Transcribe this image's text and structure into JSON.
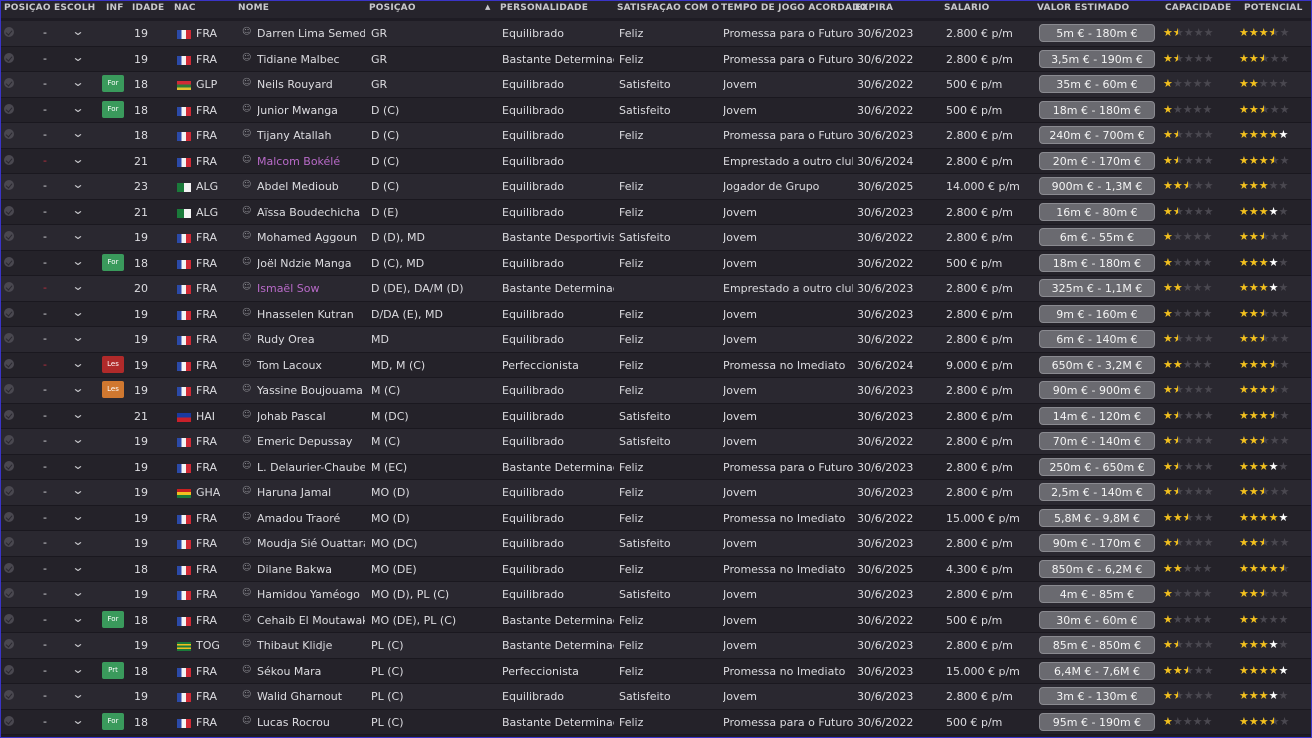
{
  "headers": {
    "posicao_escolhida": "POSIÇÃO ESCOLHIDA",
    "inf": "INF",
    "idade": "IDADE",
    "nac": "NAC",
    "nome": "NOME",
    "posicao": "POSIÇÃO",
    "personalidade": "PERSONALIDADE",
    "satisfacao": "SATISFAÇÃO COM O TE...",
    "tempo": "TEMPO DE JOGO ACORDADO",
    "expira": "EXPIRA",
    "salario": "SALÁRIO",
    "valor": "VALOR ESTIMADO",
    "capacidade": "CAPACIDADE",
    "potencial": "POTENCIAL"
  },
  "colors": {
    "star": "#f2c01e",
    "loan_name": "#b86ac8",
    "for_badge": "#3a9a5c",
    "les_badge_red": "#b02a2a",
    "les_badge_orange": "#d07830"
  },
  "players": [
    {
      "dash": "-",
      "inf": "",
      "age": "19",
      "flag": "fra",
      "nac": "FRA",
      "name": "Darren Lima Semedo",
      "pos": "GR",
      "pers": "Equilibrado",
      "sat": "Feliz",
      "tempo": "Promessa para o Futuro",
      "exp": "30/6/2023",
      "sal": "2.800 € p/m",
      "val": "5m € - 180m €",
      "cap": "1.5",
      "pot": "3.5"
    },
    {
      "dash": "-",
      "inf": "",
      "age": "19",
      "flag": "fra",
      "nac": "FRA",
      "name": "Tidiane Malbec",
      "pos": "GR",
      "pers": "Bastante Determinado",
      "sat": "Feliz",
      "tempo": "Promessa para o Futuro",
      "exp": "30/6/2022",
      "sal": "2.800 € p/m",
      "val": "3,5m € - 190m €",
      "cap": "1.5",
      "pot": "2.5"
    },
    {
      "dash": "-",
      "inf": "For",
      "age": "18",
      "flag": "glp",
      "nac": "GLP",
      "name": "Neils Rouyard",
      "pos": "GR",
      "pers": "Equilibrado",
      "sat": "Satisfeito",
      "tempo": "Jovem",
      "exp": "30/6/2022",
      "sal": "500 € p/m",
      "val": "35m € - 60m €",
      "cap": "1",
      "pot": "2"
    },
    {
      "dash": "-",
      "inf": "For",
      "age": "18",
      "flag": "fra",
      "nac": "FRA",
      "name": "Junior Mwanga",
      "pos": "D (C)",
      "pers": "Equilibrado",
      "sat": "Satisfeito",
      "tempo": "Jovem",
      "exp": "30/6/2022",
      "sal": "500 € p/m",
      "val": "18m € - 180m €",
      "cap": "1",
      "pot": "2.5"
    },
    {
      "dash": "-",
      "inf": "",
      "age": "18",
      "flag": "fra",
      "nac": "FRA",
      "name": "Tijany Atallah",
      "pos": "D (C)",
      "pers": "Equilibrado",
      "sat": "Feliz",
      "tempo": "Promessa para o Futuro",
      "exp": "30/6/2023",
      "sal": "2.800 € p/m",
      "val": "240m € - 700m €",
      "cap": "1.5",
      "pot": "4w"
    },
    {
      "dash": "-",
      "red": true,
      "inf": "",
      "age": "21",
      "flag": "fra",
      "nac": "FRA",
      "name": "Malcom Bokélé",
      "loan": true,
      "pos": "D (C)",
      "pers": "Equilibrado",
      "sat": "",
      "tempo": "Emprestado a outro clube",
      "exp": "30/6/2024",
      "sal": "2.800 € p/m",
      "val": "20m € - 170m €",
      "cap": "1.5",
      "pot": "3.5"
    },
    {
      "dash": "-",
      "inf": "",
      "age": "23",
      "flag": "alg",
      "nac": "ALG",
      "name": "Abdel Medioub",
      "pos": "D (C)",
      "pers": "Equilibrado",
      "sat": "Feliz",
      "tempo": "Jogador de Grupo",
      "exp": "30/6/2025",
      "sal": "14.000 € p/m",
      "val": "900m € - 1,3M €",
      "cap": "2.5",
      "pot": "3"
    },
    {
      "dash": "-",
      "inf": "",
      "age": "21",
      "flag": "alg",
      "nac": "ALG",
      "name": "Aïssa Boudechicha",
      "pos": "D (E)",
      "pers": "Equilibrado",
      "sat": "Feliz",
      "tempo": "Jovem",
      "exp": "30/6/2023",
      "sal": "2.800 € p/m",
      "val": "16m € - 80m €",
      "cap": "1.5",
      "pot": "3w"
    },
    {
      "dash": "-",
      "inf": "",
      "age": "19",
      "flag": "fra",
      "nac": "FRA",
      "name": "Mohamed Aggoun",
      "pos": "D (D), MD",
      "pers": "Bastante Desportivista",
      "sat": "Satisfeito",
      "tempo": "Jovem",
      "exp": "30/6/2022",
      "sal": "2.800 € p/m",
      "val": "6m € - 55m €",
      "cap": "1",
      "pot": "2.5"
    },
    {
      "dash": "-",
      "inf": "For",
      "age": "18",
      "flag": "fra",
      "nac": "FRA",
      "name": "Joël Ndzie Manga",
      "pos": "D (C), MD",
      "pers": "Equilibrado",
      "sat": "Feliz",
      "tempo": "Jovem",
      "exp": "30/6/2022",
      "sal": "500 € p/m",
      "val": "18m € - 180m €",
      "cap": "1",
      "pot": "3w"
    },
    {
      "dash": "-",
      "red": true,
      "inf": "",
      "age": "20",
      "flag": "fra",
      "nac": "FRA",
      "name": "Ismaël Sow",
      "loan": true,
      "pos": "D (DE), DA/M (D)",
      "pers": "Bastante Determinado",
      "sat": "",
      "tempo": "Emprestado a outro clube",
      "exp": "30/6/2023",
      "sal": "2.800 € p/m",
      "val": "325m € - 1,1M €",
      "cap": "2",
      "pot": "3w"
    },
    {
      "dash": "-",
      "inf": "",
      "age": "19",
      "flag": "fra",
      "nac": "FRA",
      "name": "Hnasselen Kutran",
      "pos": "D/DA (E), MD",
      "pers": "Equilibrado",
      "sat": "Feliz",
      "tempo": "Jovem",
      "exp": "30/6/2023",
      "sal": "2.800 € p/m",
      "val": "9m € - 160m €",
      "cap": "1",
      "pot": "2.5"
    },
    {
      "dash": "-",
      "inf": "",
      "age": "19",
      "flag": "fra",
      "nac": "FRA",
      "name": "Rudy Orea",
      "pos": "MD",
      "pers": "Equilibrado",
      "sat": "Feliz",
      "tempo": "Jovem",
      "exp": "30/6/2022",
      "sal": "2.800 € p/m",
      "val": "6m € - 140m €",
      "cap": "1.5",
      "pot": "2.5"
    },
    {
      "dash": "-",
      "red": true,
      "inf": "Les",
      "infType": "les-red",
      "age": "19",
      "flag": "fra",
      "nac": "FRA",
      "name": "Tom Lacoux",
      "pos": "MD, M (C)",
      "pers": "Perfeccionista",
      "sat": "Feliz",
      "tempo": "Promessa no Imediato",
      "exp": "30/6/2024",
      "sal": "9.000 € p/m",
      "val": "650m € - 3,2M €",
      "cap": "2",
      "pot": "3.5"
    },
    {
      "dash": "-",
      "inf": "Les",
      "infType": "les-orange",
      "age": "19",
      "flag": "fra",
      "nac": "FRA",
      "name": "Yassine Boujouama",
      "pos": "M (C)",
      "pers": "Equilibrado",
      "sat": "Feliz",
      "tempo": "Jovem",
      "exp": "30/6/2023",
      "sal": "2.800 € p/m",
      "val": "90m € - 900m €",
      "cap": "1.5",
      "pot": "3.5"
    },
    {
      "dash": "-",
      "inf": "",
      "age": "21",
      "flag": "hai",
      "nac": "HAI",
      "name": "Johab Pascal",
      "pos": "M (DC)",
      "pers": "Equilibrado",
      "sat": "Satisfeito",
      "tempo": "Jovem",
      "exp": "30/6/2023",
      "sal": "2.800 € p/m",
      "val": "14m € - 120m €",
      "cap": "1.5",
      "pot": "3.5"
    },
    {
      "dash": "-",
      "inf": "",
      "age": "19",
      "flag": "fra",
      "nac": "FRA",
      "name": "Emeric Depussay",
      "pos": "M (C)",
      "pers": "Equilibrado",
      "sat": "Satisfeito",
      "tempo": "Jovem",
      "exp": "30/6/2022",
      "sal": "2.800 € p/m",
      "val": "70m € - 140m €",
      "cap": "1.5",
      "pot": "2.5"
    },
    {
      "dash": "-",
      "inf": "",
      "age": "19",
      "flag": "fra",
      "nac": "FRA",
      "name": "L. Delaurier-Chaubet",
      "pos": "M (EC)",
      "pers": "Bastante Determinado",
      "sat": "Feliz",
      "tempo": "Promessa para o Futuro",
      "exp": "30/6/2023",
      "sal": "2.800 € p/m",
      "val": "250m € - 650m €",
      "cap": "1.5",
      "pot": "3w"
    },
    {
      "dash": "-",
      "inf": "",
      "age": "19",
      "flag": "gha",
      "nac": "GHA",
      "name": "Haruna Jamal",
      "pos": "MO (D)",
      "pers": "Equilibrado",
      "sat": "Feliz",
      "tempo": "Jovem",
      "exp": "30/6/2023",
      "sal": "2.800 € p/m",
      "val": "2,5m € - 140m €",
      "cap": "1.5",
      "pot": "2.5"
    },
    {
      "dash": "-",
      "inf": "",
      "age": "19",
      "flag": "fra",
      "nac": "FRA",
      "name": "Amadou Traoré",
      "pos": "MO (D)",
      "pers": "Equilibrado",
      "sat": "Feliz",
      "tempo": "Promessa no Imediato",
      "exp": "30/6/2022",
      "sal": "15.000 € p/m",
      "val": "5,8M € - 9,8M €",
      "cap": "2.5",
      "pot": "4w"
    },
    {
      "dash": "-",
      "inf": "",
      "age": "19",
      "flag": "fra",
      "nac": "FRA",
      "name": "Moudja Sié Ouattara",
      "pos": "MO (DC)",
      "pers": "Equilibrado",
      "sat": "Satisfeito",
      "tempo": "Jovem",
      "exp": "30/6/2023",
      "sal": "2.800 € p/m",
      "val": "90m € - 170m €",
      "cap": "1.5",
      "pot": "2.5"
    },
    {
      "dash": "-",
      "inf": "",
      "age": "18",
      "flag": "fra",
      "nac": "FRA",
      "name": "Dilane Bakwa",
      "pos": "MO (DE)",
      "pers": "Equilibrado",
      "sat": "Feliz",
      "tempo": "Promessa no Imediato",
      "exp": "30/6/2025",
      "sal": "4.300 € p/m",
      "val": "850m € - 6,2M €",
      "cap": "2",
      "pot": "4.5"
    },
    {
      "dash": "-",
      "inf": "",
      "age": "19",
      "flag": "fra",
      "nac": "FRA",
      "name": "Hamidou Yaméogo",
      "pos": "MO (D), PL (C)",
      "pers": "Equilibrado",
      "sat": "Satisfeito",
      "tempo": "Jovem",
      "exp": "30/6/2023",
      "sal": "2.800 € p/m",
      "val": "4m € - 85m €",
      "cap": "1",
      "pot": "2.5"
    },
    {
      "dash": "-",
      "inf": "For",
      "age": "18",
      "flag": "fra",
      "nac": "FRA",
      "name": "Cehaib El Moutawakil",
      "pos": "MO (DE), PL (C)",
      "pers": "Bastante Determinado",
      "sat": "Feliz",
      "tempo": "Jovem",
      "exp": "30/6/2022",
      "sal": "500 € p/m",
      "val": "30m € - 60m €",
      "cap": "1",
      "pot": "2"
    },
    {
      "dash": "-",
      "inf": "",
      "age": "19",
      "flag": "tog",
      "nac": "TOG",
      "name": "Thibaut Klidje",
      "pos": "PL (C)",
      "pers": "Bastante Determinado",
      "sat": "Feliz",
      "tempo": "Jovem",
      "exp": "30/6/2023",
      "sal": "2.800 € p/m",
      "val": "85m € - 850m €",
      "cap": "1.5",
      "pot": "3w"
    },
    {
      "dash": "-",
      "inf": "Prt",
      "age": "18",
      "flag": "fra",
      "nac": "FRA",
      "name": "Sékou Mara",
      "pos": "PL (C)",
      "pers": "Perfeccionista",
      "sat": "Feliz",
      "tempo": "Promessa no Imediato",
      "exp": "30/6/2023",
      "sal": "15.000 € p/m",
      "val": "6,4M € - 7,6M €",
      "cap": "2.5",
      "pot": "4w"
    },
    {
      "dash": "-",
      "inf": "",
      "age": "19",
      "flag": "fra",
      "nac": "FRA",
      "name": "Walid Gharnout",
      "pos": "PL (C)",
      "pers": "Equilibrado",
      "sat": "Satisfeito",
      "tempo": "Jovem",
      "exp": "30/6/2023",
      "sal": "2.800 € p/m",
      "val": "3m € - 130m €",
      "cap": "1.5",
      "pot": "3w"
    },
    {
      "dash": "-",
      "inf": "For",
      "age": "18",
      "flag": "fra",
      "nac": "FRA",
      "name": "Lucas Rocrou",
      "pos": "PL (C)",
      "pers": "Bastante Determinado",
      "sat": "Feliz",
      "tempo": "Promessa para o Futuro",
      "exp": "30/6/2022",
      "sal": "500 € p/m",
      "val": "95m € - 190m €",
      "cap": "1",
      "pot": "3.5"
    }
  ]
}
